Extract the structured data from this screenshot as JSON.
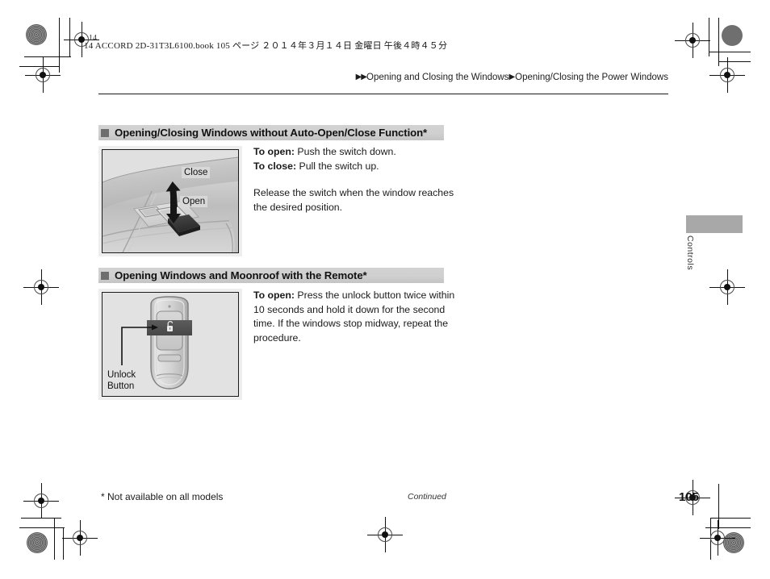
{
  "print_marks": {
    "job_slug": "14 ACCORD 2D-31T3L6100.book   105 ページ   ２０１４年３月１４日   金曜日   午後４時４５分",
    "corner_number": "14"
  },
  "header": {
    "breadcrumb": [
      {
        "arrow": "▶▶",
        "label": "Opening and Closing the Windows"
      },
      {
        "arrow": "▶",
        "label": "Opening/Closing the Power Windows"
      }
    ]
  },
  "sections": [
    {
      "id": "without-auto",
      "heading": "Opening/Closing Windows without Auto-Open/Close Function*",
      "figure": {
        "name": "power-window-switch-illustration",
        "labels": [
          {
            "text": "Close"
          },
          {
            "text": "Open"
          }
        ]
      },
      "body": {
        "line1_bold": "To open:",
        "line1_rest": " Push the switch down.",
        "line2_bold": "To close:",
        "line2_rest": " Pull the switch up.",
        "paragraph2": "Release the switch when the window reaches the desired position."
      }
    },
    {
      "id": "with-remote",
      "heading": "Opening Windows and Moonroof with the Remote*",
      "figure": {
        "name": "remote-key-fob-illustration",
        "labels": [
          {
            "text": "Unlock"
          },
          {
            "text": "Button"
          }
        ],
        "icon": "unlock-icon"
      },
      "body": {
        "line1_bold": "To open:",
        "line1_rest": " Press the unlock button twice within 10 seconds and hold it down for the second time. If the windows stop midway, repeat the procedure."
      }
    }
  ],
  "side_tab": {
    "label": "Controls"
  },
  "footer": {
    "footnote": "* Not available on all models",
    "continued": "Continued",
    "page_number": "105"
  },
  "colors": {
    "heading_bar": "#d0d0d0",
    "heading_square": "#6e6e6e",
    "figure_bg": "#e9e9e9",
    "thumb_tab": "#a8a8a8",
    "text": "#1a1a1a"
  }
}
